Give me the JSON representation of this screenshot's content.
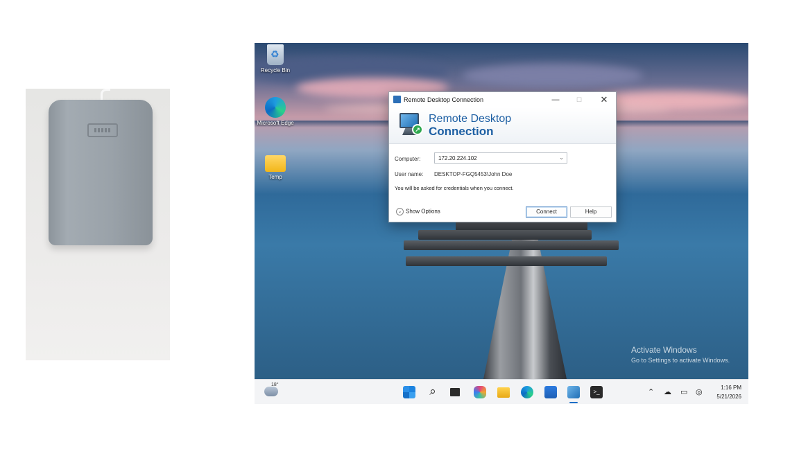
{
  "desktop_icons": [
    {
      "label": "Recycle Bin",
      "icon": "recycle-bin-icon"
    },
    {
      "label": "Microsoft Edge",
      "icon": "edge-icon"
    },
    {
      "label": "Temp",
      "icon": "folder-icon"
    }
  ],
  "activation": {
    "title": "Activate Windows",
    "subtitle": "Go to Settings to activate Windows."
  },
  "rdc": {
    "window_title": "Remote Desktop Connection",
    "heading_line1": "Remote Desktop",
    "heading_line2": "Connection",
    "computer_label": "Computer:",
    "computer_value": "172.20.224.102",
    "username_label": "User name:",
    "username_value": "DESKTOP-FGQ5453\\John Doe",
    "credentials_note": "You will be asked for credentials when you connect.",
    "show_options_label": "Show Options",
    "connect_label": "Connect",
    "help_label": "Help"
  },
  "taskbar": {
    "temperature": "18°",
    "apps": [
      "start-icon",
      "search-icon",
      "task-view-icon",
      "copilot-icon",
      "file-explorer-icon",
      "edge-icon",
      "store-icon",
      "remote-desktop-icon",
      "terminal-icon"
    ],
    "tray_icons": [
      "chevron-up-icon",
      "cloud-off-icon",
      "display-icon",
      "network-icon"
    ],
    "time": "1:16 PM",
    "date": "5/21/2026"
  },
  "colors": {
    "rdc_heading": "#1d5fa3",
    "accent": "#1d6fc7"
  }
}
